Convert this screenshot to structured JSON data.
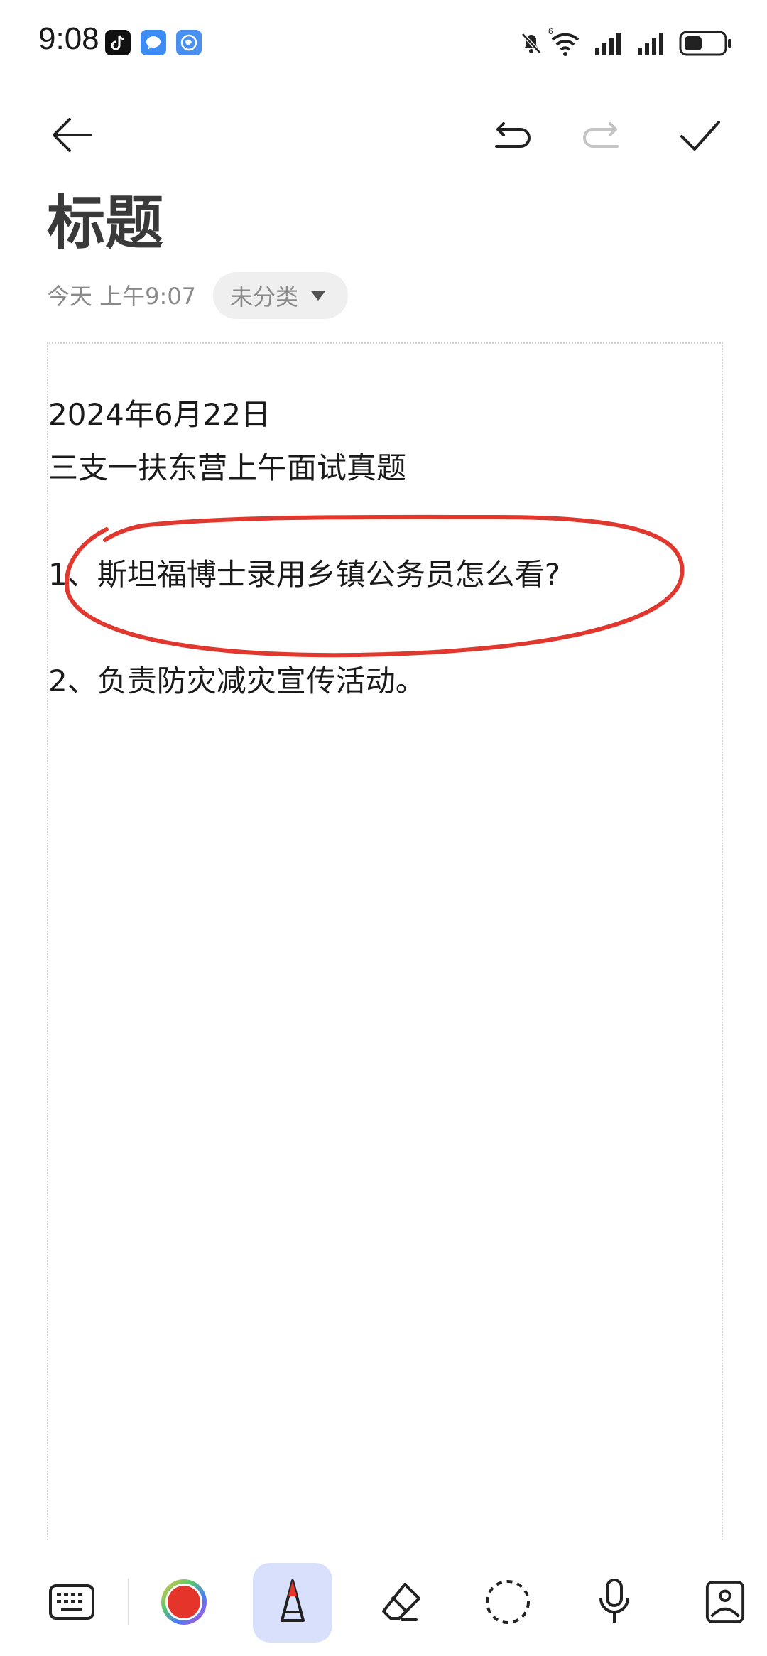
{
  "status_bar": {
    "time": "9:08",
    "icons": [
      "tiktok-icon",
      "message-icon",
      "browser-icon",
      "mute-bell-icon",
      "wifi-icon",
      "signal-icon",
      "signal-icon",
      "battery-icon"
    ]
  },
  "toolbar": {
    "back": "back-arrow-icon",
    "undo": "undo-icon",
    "redo": "redo-icon",
    "done": "checkmark-icon"
  },
  "note": {
    "title": "标题",
    "date": "今天 上午9:07",
    "category": "未分类",
    "lines": [
      "2024年6月22日",
      "三支一扶东营上午面试真题",
      "1、斯坦福博士录用乡镇公务员怎么看?",
      "2、负责防灾减灾宣传活动。"
    ],
    "annotation_color": "#e0382f"
  },
  "bottom_bar": {
    "tools": [
      "keyboard-icon",
      "color-picker-icon",
      "pen-icon",
      "eraser-icon",
      "lasso-icon",
      "microphone-icon",
      "image-icon"
    ],
    "active_tool": "pen-icon",
    "pen_color": "#e5352b",
    "active_bg": "#d8e0fb"
  }
}
